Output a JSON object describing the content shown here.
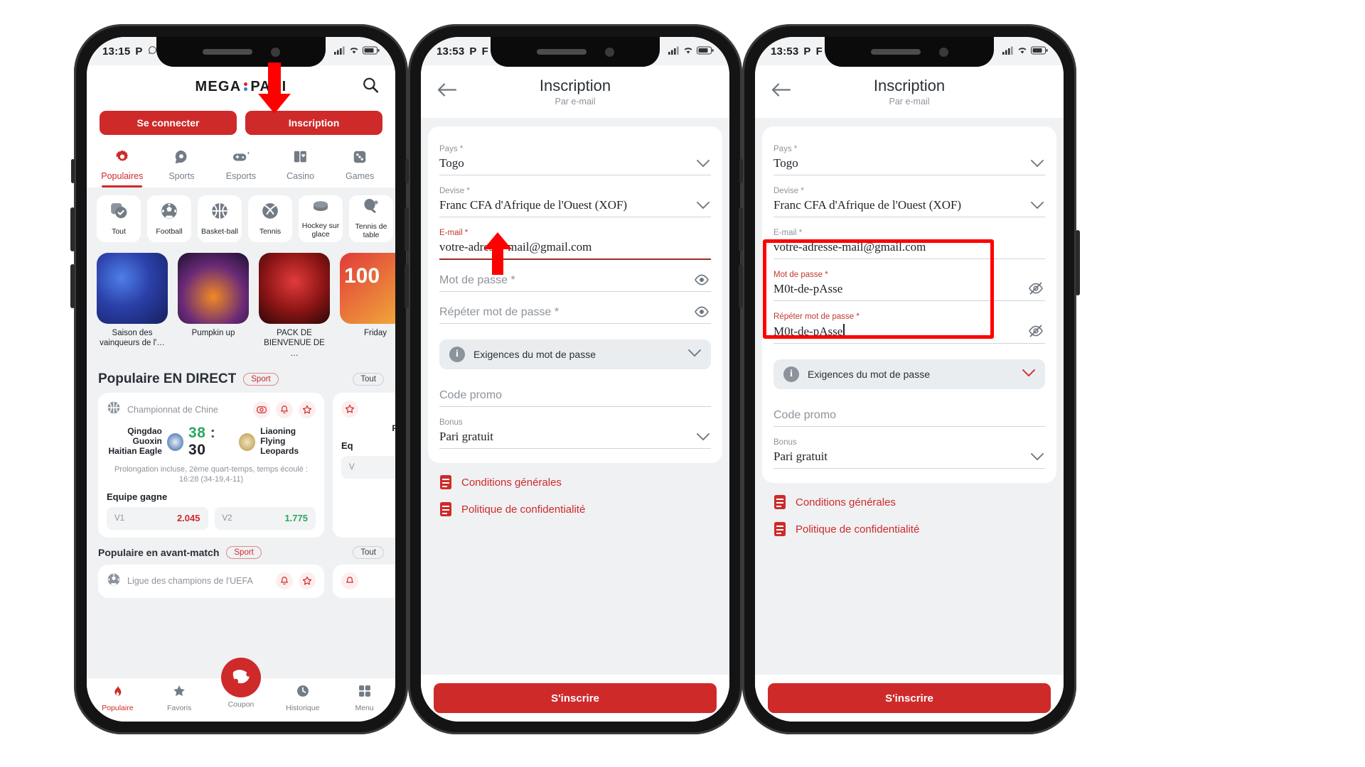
{
  "phone1": {
    "statusbar": {
      "time": "13:15",
      "left_icons": [
        "P",
        "whatsapp-icon"
      ],
      "right_icons": [
        "signal-icon",
        "wifi-icon",
        "battery-icon"
      ]
    },
    "header": {
      "brand_left": "MEGA",
      "brand_right": "PARI",
      "search_icon": "search-icon"
    },
    "auth": {
      "login_label": "Se connecter",
      "register_label": "Inscription"
    },
    "top_tabs": [
      {
        "label": "Populaires",
        "icon": "flower-gear-icon",
        "active": true
      },
      {
        "label": "Sports",
        "icon": "football-chat-icon",
        "active": false
      },
      {
        "label": "Esports",
        "icon": "gamepad-icon",
        "active": false
      },
      {
        "label": "Casino",
        "icon": "cards-icon",
        "active": false
      },
      {
        "label": "Games",
        "icon": "dice-icon",
        "active": false
      }
    ],
    "sport_chips": [
      {
        "label": "Tout",
        "icon": "check-stack-icon"
      },
      {
        "label": "Football",
        "icon": "football-icon"
      },
      {
        "label": "Basket-ball",
        "icon": "basketball-icon"
      },
      {
        "label": "Tennis",
        "icon": "tennis-ball-icon"
      },
      {
        "label": "Hockey sur glace",
        "icon": "hockey-puck-icon"
      },
      {
        "label": "Tennis de table",
        "icon": "table-tennis-icon"
      }
    ],
    "promos": [
      {
        "caption": "Saison des vainqueurs de l'…",
        "art": "football-player-art"
      },
      {
        "caption": "Pumpkin up",
        "art": "pumpkin-art"
      },
      {
        "caption": "PACK DE BIENVENUE DE …",
        "art": "knight-art"
      },
      {
        "caption": "Friday",
        "art": "friday-100-art",
        "badge": "100"
      }
    ],
    "live_section": {
      "title": "Populaire EN DIRECT",
      "badge": "Sport",
      "all_label": "Tout",
      "match": {
        "league": "Championnat de Chine",
        "league_icon": "basketball-icon",
        "home_team": "Qingdao Guoxin Haitian Eagle",
        "away_team": "Liaoning Flying Leopards",
        "home_score": "38",
        "score_sep": ":",
        "away_score": "30",
        "note": "Prolongation incluse, 2ème quart-temps, temps écoulé : 16:28 (34-19,4-11)",
        "market": "Equipe gagne",
        "odds": [
          {
            "key": "V1",
            "value": "2.045",
            "color": "red"
          },
          {
            "key": "V2",
            "value": "1.775",
            "color": "green"
          }
        ],
        "actions": [
          "stats-icon",
          "bell-icon",
          "star-icon"
        ]
      }
    },
    "prematch_section": {
      "title": "Populaire en avant-match",
      "badge": "Sport",
      "all_label": "Tout",
      "match": {
        "league": "Ligue des champions de l'UEFA",
        "league_icon": "football-icon",
        "actions": [
          "bell-icon",
          "star-icon"
        ]
      }
    },
    "bottom_nav": [
      {
        "label": "Populaire",
        "icon": "flame-icon",
        "active": true
      },
      {
        "label": "Favoris",
        "icon": "star-icon",
        "active": false
      },
      {
        "label": "Coupon",
        "icon": "ticket-icon",
        "active": false
      },
      {
        "label": "Historique",
        "icon": "clock-icon",
        "active": false
      },
      {
        "label": "Menu",
        "icon": "grid-icon",
        "active": false
      }
    ]
  },
  "phone2": {
    "statusbar": {
      "time": "13:53",
      "left_icons": [
        "P",
        "F"
      ],
      "right_icons": [
        "signal-icon",
        "wifi-icon",
        "battery-icon"
      ]
    },
    "header": {
      "title": "Inscription",
      "subtitle": "Par e-mail",
      "back_icon": "back-arrow-icon"
    },
    "fields": [
      {
        "name": "country",
        "label": "Pays *",
        "value": "Togo",
        "type": "select",
        "required_highlight": false
      },
      {
        "name": "currency",
        "label": "Devise *",
        "value": "Franc CFA d'Afrique de l'Ouest (XOF)",
        "type": "select",
        "required_highlight": false
      },
      {
        "name": "email",
        "label": "E-mail *",
        "value": "votre-adresse-mail@gmail.com",
        "type": "text",
        "required_highlight": true
      },
      {
        "name": "password",
        "label": "Mot de passe *",
        "value": "",
        "placeholder": "Mot de passe *",
        "type": "password",
        "required_highlight": false
      },
      {
        "name": "password_repeat",
        "label": "Répéter mot de passe *",
        "value": "",
        "placeholder": "Répéter mot de passe *",
        "type": "password",
        "required_highlight": false
      },
      {
        "name": "promo",
        "label": "Code promo",
        "value": "",
        "placeholder": "Code promo",
        "type": "text",
        "required_highlight": false
      },
      {
        "name": "bonus",
        "label": "Bonus",
        "value": "Pari gratuit",
        "type": "select",
        "required_highlight": false
      }
    ],
    "info_box": {
      "text": "Exigences du mot de passe",
      "icon": "info-icon",
      "chevron": "chevron-down-icon"
    },
    "links": [
      {
        "label": "Conditions générales",
        "icon": "document-icon"
      },
      {
        "label": "Politique de confidentialité",
        "icon": "document-icon"
      }
    ],
    "submit_label": "S'inscrire"
  },
  "phone3": {
    "statusbar": {
      "time": "13:53",
      "left_icons": [
        "P",
        "F"
      ],
      "right_icons": [
        "signal-icon",
        "wifi-icon",
        "battery-icon"
      ]
    },
    "header": {
      "title": "Inscription",
      "subtitle": "Par e-mail",
      "back_icon": "back-arrow-icon"
    },
    "fields": [
      {
        "name": "country",
        "label": "Pays *",
        "value": "Togo",
        "type": "select"
      },
      {
        "name": "currency",
        "label": "Devise *",
        "value": "Franc CFA d'Afrique de l'Ouest (XOF)",
        "type": "select"
      },
      {
        "name": "email",
        "label": "E-mail *",
        "value": "votre-adresse-mail@gmail.com",
        "type": "text"
      },
      {
        "name": "password",
        "label": "Mot de passe *",
        "value": "M0t-de-pAsse",
        "type": "password-visible"
      },
      {
        "name": "password_repeat",
        "label": "Répéter mot de passe *",
        "value": "M0t-de-pAsse",
        "type": "password-visible"
      },
      {
        "name": "promo",
        "label": "Code promo",
        "value": "",
        "placeholder": "Code promo",
        "type": "text"
      },
      {
        "name": "bonus",
        "label": "Bonus",
        "value": "Pari gratuit",
        "type": "select"
      }
    ],
    "info_box": {
      "text": "Exigences du mot de passe",
      "icon": "info-icon",
      "chevron": "chevron-down-icon"
    },
    "links": [
      {
        "label": "Conditions générales",
        "icon": "document-icon"
      },
      {
        "label": "Politique de confidentialité",
        "icon": "document-icon"
      }
    ],
    "submit_label": "S'inscrire"
  },
  "annotations": {
    "arrow_register": "red-down-arrow-icon",
    "arrow_email": "red-up-arrow-icon",
    "highlight_passwords": "red-rectangle-highlight"
  },
  "colors": {
    "brand_red": "#cf2a2a",
    "annotation_red": "#ff0000",
    "text_dark": "#20242a",
    "text_muted": "#8d939b",
    "page_bg": "#eff1f3",
    "odds_red": "#cf2a2a",
    "odds_green": "#2aa861"
  }
}
